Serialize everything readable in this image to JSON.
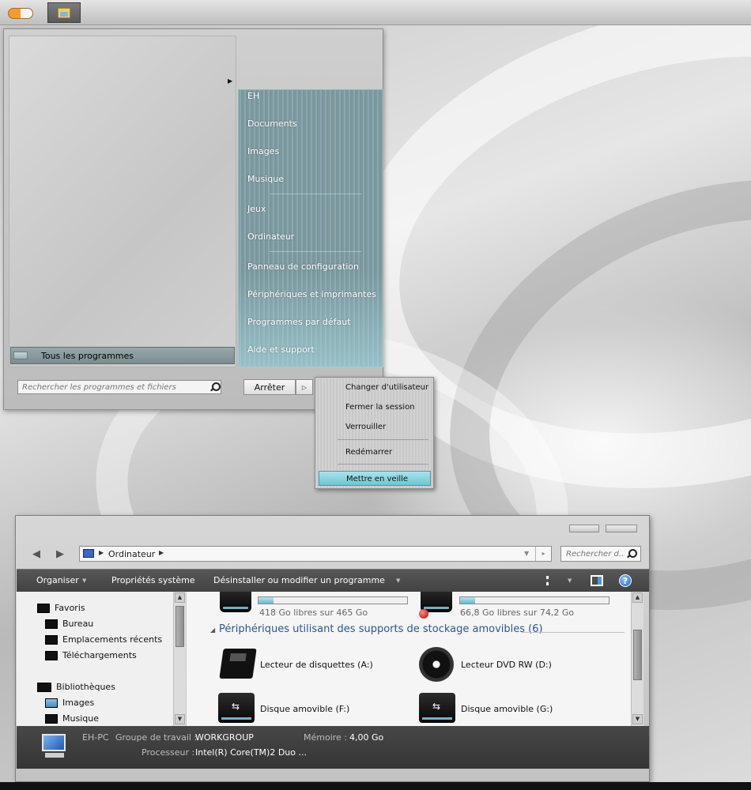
{
  "start_menu": {
    "all_programs_label": "Tous les programmes",
    "search_placeholder": "Rechercher les programmes et fichiers",
    "shutdown_label": "Arrêter",
    "places": [
      "EH",
      "Documents",
      "Images",
      "Musique",
      "Jeux",
      "Ordinateur",
      "Panneau de configuration",
      "Périphériques et imprimantes",
      "Programmes par défaut",
      "Aide et support"
    ]
  },
  "power_menu": {
    "items": [
      "Changer d'utilisateur",
      "Fermer la session",
      "Verrouiller",
      "Redémarrer",
      "Mettre en veille"
    ],
    "highlighted": "Mettre en veille"
  },
  "explorer": {
    "address": {
      "path": "Ordinateur"
    },
    "search_placeholder": "Rechercher d...",
    "commands": [
      "Organiser",
      "Propriétés système",
      "Désinstaller ou modifier un programme"
    ],
    "nav": {
      "favorites_header": "Favoris",
      "favorites": [
        "Bureau",
        "Emplacements récents",
        "Téléchargements"
      ],
      "libraries_header": "Bibliothèques",
      "libraries": [
        "Images",
        "Musique"
      ]
    },
    "drives": [
      {
        "free_text": "418 Go libres sur 465 Go",
        "used_fraction": 0.1
      },
      {
        "free_text": "66,8 Go libres sur 74,2 Go",
        "used_fraction": 0.1
      }
    ],
    "removable_section": "Périphériques utilisant des supports de stockage amovibles (6)",
    "devices": [
      "Lecteur de disquettes (A:)",
      "Lecteur DVD RW (D:)",
      "Disque amovible (F:)",
      "Disque amovible (G:)"
    ],
    "details": {
      "computer_name": "EH-PC",
      "workgroup_label": "Groupe de travail :",
      "workgroup_value": "WORKGROUP",
      "memory_label": "Mémoire :",
      "memory_value": "4,00 Go",
      "processor_label": "Processeur :",
      "processor_value": "Intel(R) Core(TM)2 Duo ..."
    }
  },
  "colors": {
    "accent_highlight": "#8fd6e2",
    "places_pane": "#7f9ca0",
    "command_bar": "#4a4a4a",
    "section_header": "#2d5593"
  }
}
